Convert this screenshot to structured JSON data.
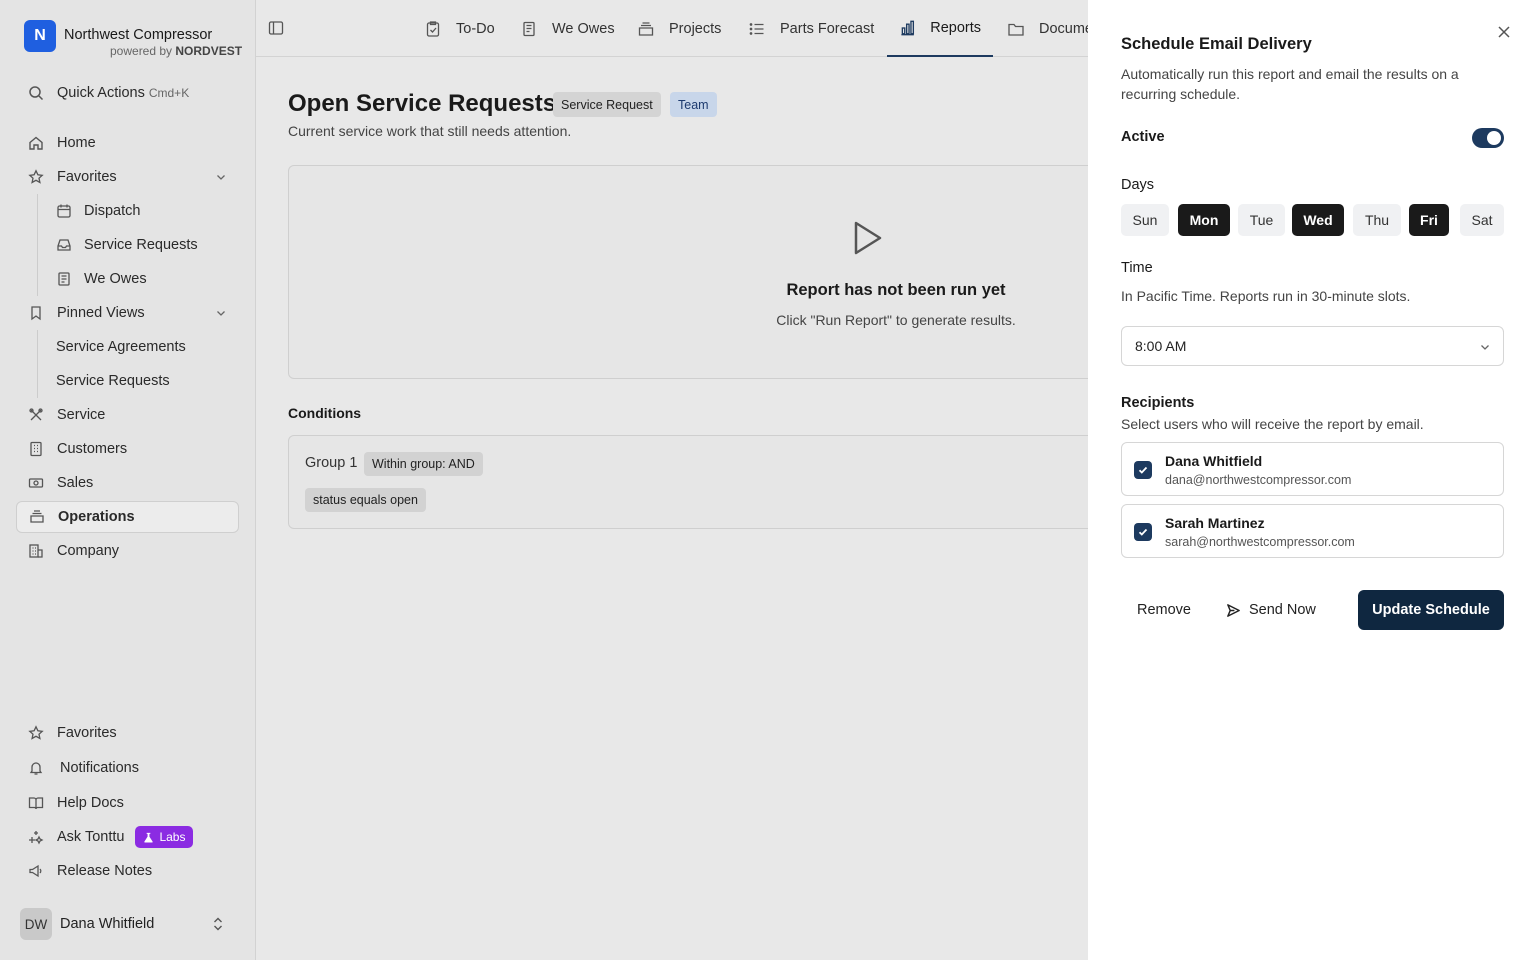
{
  "brand": {
    "initial": "N",
    "name": "Northwest Compressor",
    "powered_prefix": "powered by",
    "powered_brand": "NORDVEST"
  },
  "sidebar": {
    "quick_actions": {
      "label": "Quick Actions",
      "shortcut": "Cmd+K"
    },
    "home": "Home",
    "favorites": {
      "label": "Favorites",
      "items": [
        "Dispatch",
        "Service Requests",
        "We Owes"
      ]
    },
    "pinned_views": {
      "label": "Pinned Views",
      "items": [
        "Service Agreements",
        "Service Requests"
      ]
    },
    "service": "Service",
    "customers": "Customers",
    "sales": "Sales",
    "operations": "Operations",
    "company": "Company",
    "bottom": {
      "favorites": "Favorites",
      "notifications": "Notifications",
      "help_docs": "Help Docs",
      "ask": "Ask Tonttu",
      "labs": "Labs",
      "release_notes": "Release Notes"
    },
    "user": {
      "initials": "DW",
      "name": "Dana Whitfield"
    }
  },
  "tabs": [
    "To-Do",
    "We Owes",
    "Projects",
    "Parts Forecast",
    "Reports",
    "Docume"
  ],
  "report": {
    "title": "Open Service Requests",
    "badges": [
      "Service Request",
      "Team"
    ],
    "subtitle": "Current service work that still needs attention.",
    "empty_title": "Report has not been run yet",
    "empty_sub": "Click \"Run Report\" to generate results.",
    "conditions_label": "Conditions",
    "group_label": "Group 1",
    "group_logic": "Within group: AND",
    "condition": "status equals open"
  },
  "schedule": {
    "title": "Schedule Email Delivery",
    "description": "Automatically run this report and email the results on a recurring schedule.",
    "active_label": "Active",
    "active": true,
    "days_label": "Days",
    "days": [
      {
        "label": "Sun",
        "selected": false
      },
      {
        "label": "Mon",
        "selected": true
      },
      {
        "label": "Tue",
        "selected": false
      },
      {
        "label": "Wed",
        "selected": true
      },
      {
        "label": "Thu",
        "selected": false
      },
      {
        "label": "Fri",
        "selected": true
      },
      {
        "label": "Sat",
        "selected": false
      }
    ],
    "time_label": "Time",
    "time_help": "In Pacific Time. Reports run in 30-minute slots.",
    "time_value": "8:00 AM",
    "recipients_label": "Recipients",
    "recipients_help": "Select users who will receive the report by email.",
    "recipients": [
      {
        "name": "Dana Whitfield",
        "email": "dana@northwestcompressor.com",
        "checked": true
      },
      {
        "name": "Sarah Martinez",
        "email": "sarah@northwestcompressor.com",
        "checked": true
      }
    ],
    "remove_label": "Remove",
    "send_now_label": "Send Now",
    "update_label": "Update Schedule"
  },
  "colors": {
    "accent": "#1d3a5f",
    "brand": "#1f5fe0",
    "labs": "#8b2be2"
  }
}
